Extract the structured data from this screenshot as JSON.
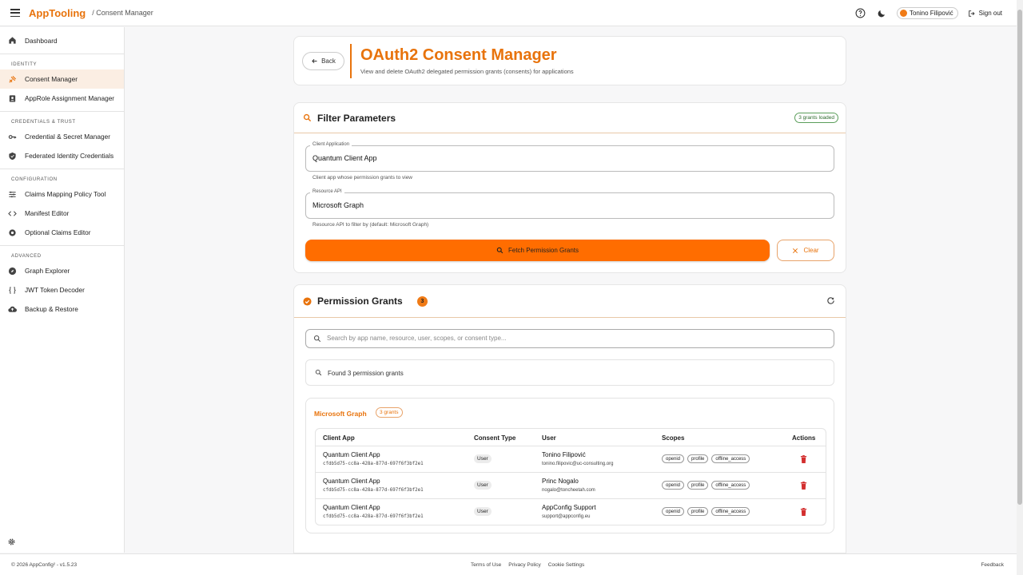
{
  "header": {
    "brand": "AppTooling",
    "breadcrumb": "/ Consent Manager",
    "user_name": "Tonino Filipović",
    "signout_label": "Sign out"
  },
  "sidebar": {
    "dashboard": "Dashboard",
    "sections": [
      {
        "title": "IDENTITY",
        "items": [
          "Consent Manager",
          "AppRole Assignment Manager"
        ]
      },
      {
        "title": "CREDENTIALS & TRUST",
        "items": [
          "Credential & Secret Manager",
          "Federated Identity Credentials"
        ]
      },
      {
        "title": "CONFIGURATION",
        "items": [
          "Claims Mapping Policy Tool",
          "Manifest Editor",
          "Optional Claims Editor"
        ]
      },
      {
        "title": "ADVANCED",
        "items": [
          "Graph Explorer",
          "JWT Token Decoder",
          "Backup & Restore"
        ]
      }
    ]
  },
  "page": {
    "back_label": "Back",
    "title": "OAuth2 Consent Manager",
    "subtitle": "View and delete OAuth2 delegated permission grants (consents) for applications"
  },
  "filter": {
    "title": "Filter Parameters",
    "badge": "3 grants loaded",
    "client_label": "Client Application",
    "client_value": "Quantum Client App",
    "client_hint": "Client app whose permission grants to view",
    "resource_label": "Resource API",
    "resource_value": "Microsoft Graph",
    "resource_hint": "Resource API to filter by (default: Microsoft Graph)",
    "fetch_label": "Fetch Permission Grants",
    "clear_label": "Clear"
  },
  "grants": {
    "title": "Permission Grants",
    "count": "3",
    "search_placeholder": "Search by app name, resource, user, scopes, or consent type...",
    "found_text": "Found 3 permission grants",
    "group_title": "Microsoft Graph",
    "group_badge": "3 grants",
    "columns": [
      "Client App",
      "Consent Type",
      "User",
      "Scopes",
      "Actions"
    ],
    "rows": [
      {
        "app": "Quantum Client App",
        "app_id": "cfdb5d75-cc8a-428a-877d-697f6f3bf2e1",
        "type": "User",
        "user": "Tonino Filipović",
        "email": "tonino.filipovic@uc-consulting.org",
        "scopes": [
          "openid",
          "profile",
          "offline_access"
        ]
      },
      {
        "app": "Quantum Client App",
        "app_id": "cfdb5d75-cc8a-428a-877d-697f6f3bf2e1",
        "type": "User",
        "user": "Princ Nogalo",
        "email": "nogalo@toncheetah.com",
        "scopes": [
          "openid",
          "profile",
          "offline_access"
        ]
      },
      {
        "app": "Quantum Client App",
        "app_id": "cfdb5d75-cc8a-428a-877d-697f6f3bf2e1",
        "type": "User",
        "user": "AppConfig Support",
        "email": "support@appconfig.eu",
        "scopes": [
          "openid",
          "profile",
          "offline_access"
        ]
      }
    ]
  },
  "footer": {
    "copyright": "© 2026 AppConfig² - v1.5.23",
    "links": [
      "Terms of Use",
      "Privacy Policy",
      "Cookie Settings"
    ],
    "feedback": "Feedback"
  },
  "colors": {
    "accent": "#e8730c",
    "button": "#ff6d00",
    "delete": "#d32f2f"
  },
  "icons": [
    "menu-icon",
    "help-icon",
    "moon-icon",
    "signout-icon",
    "home-icon",
    "consent-icon",
    "approle-icon",
    "key-icon",
    "shield-icon",
    "sliders-icon",
    "code-icon",
    "settings-icon",
    "compass-icon",
    "braces-icon",
    "cloud-icon",
    "search-icon",
    "check-circle-icon",
    "refresh-icon",
    "trash-icon",
    "close-icon",
    "arrow-left-icon"
  ]
}
